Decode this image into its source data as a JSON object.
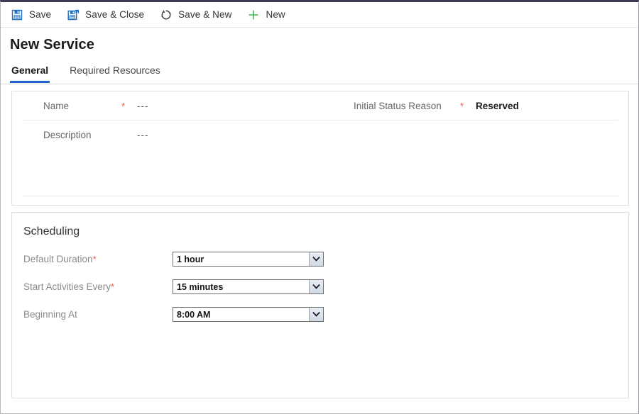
{
  "window": {
    "title": "New Service"
  },
  "commandbar": {
    "items": [
      {
        "label": "Save",
        "icon": "save-icon"
      },
      {
        "label": "Save & Close",
        "icon": "save-and-close-icon"
      },
      {
        "label": "Save & New",
        "icon": "save-and-new-icon"
      },
      {
        "label": "New",
        "icon": "plus-icon"
      }
    ]
  },
  "page": {
    "title": "New Service",
    "tabs": [
      {
        "label": "General",
        "active": true
      },
      {
        "label": "Required Resources",
        "active": false
      }
    ]
  },
  "general": {
    "fields": {
      "name": {
        "label": "Name",
        "required_marker": "*",
        "value": "---"
      },
      "initial_status_reason": {
        "label": "Initial Status Reason",
        "required_marker": "*",
        "value": "Reserved"
      },
      "description": {
        "label": "Description",
        "required_marker": "",
        "value": "---"
      }
    }
  },
  "scheduling": {
    "heading": "Scheduling",
    "fields": [
      {
        "label": "Default Duration",
        "required_marker": "*",
        "value": "1 hour"
      },
      {
        "label": "Start Activities Every",
        "required_marker": "*",
        "value": "15 minutes"
      },
      {
        "label": "Beginning At",
        "required_marker": "",
        "value": "8:00 AM"
      }
    ]
  },
  "colors": {
    "accent": "#2266cc",
    "required": "#e8554a",
    "save_icon": "#1f6fc4",
    "new_icon": "#3ab54a",
    "top_border": "#3b3b52"
  }
}
